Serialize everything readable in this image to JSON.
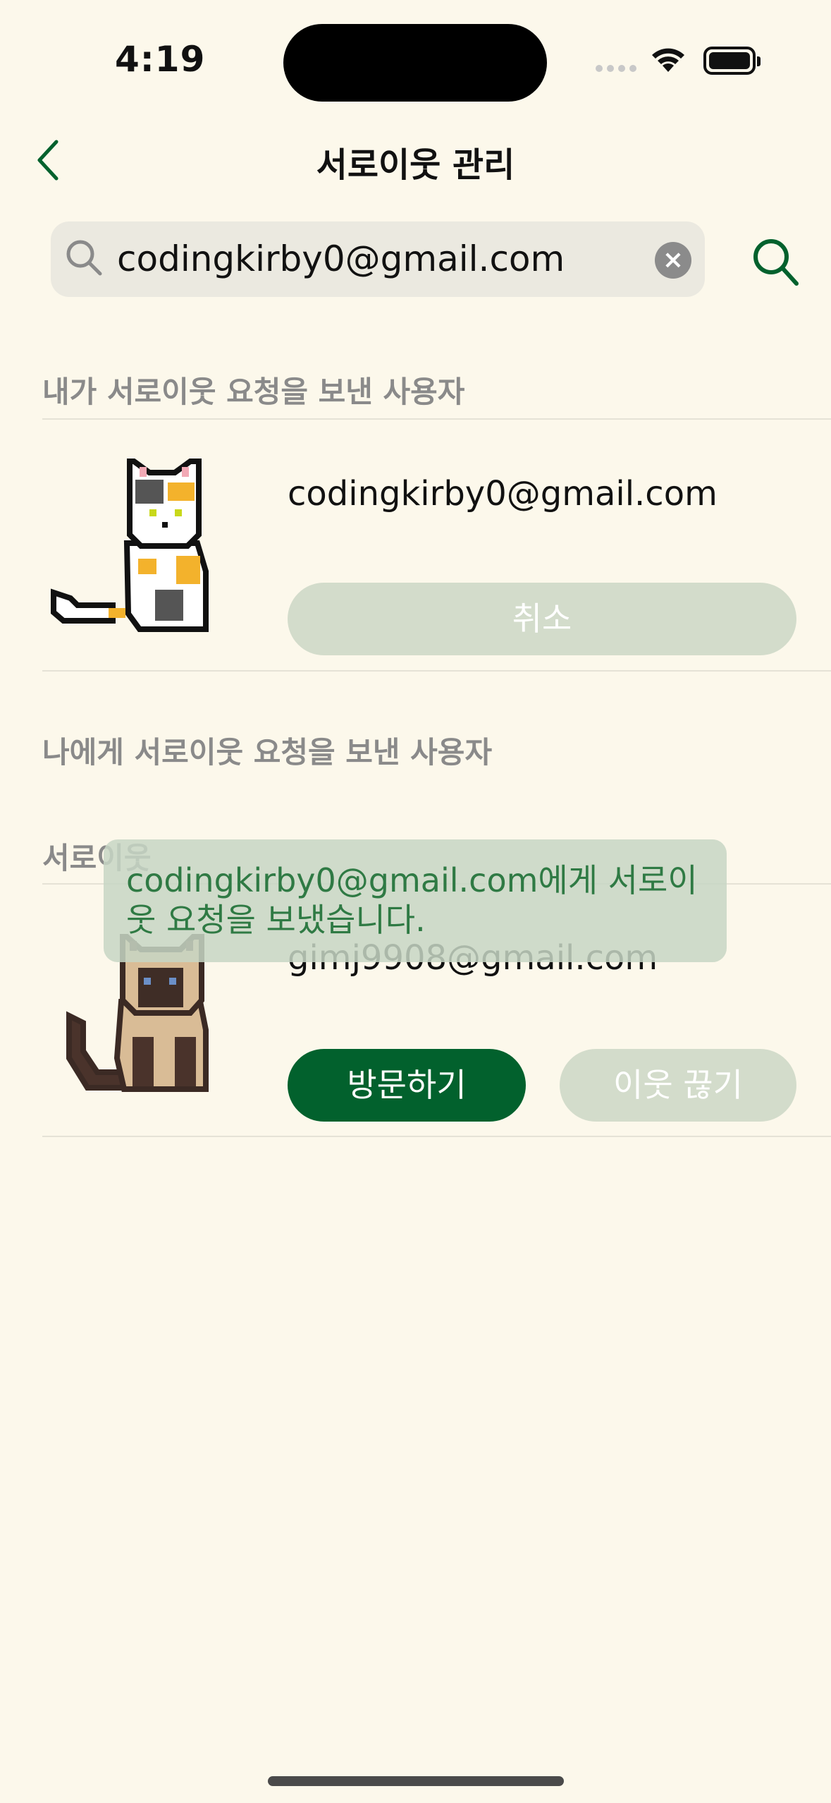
{
  "status": {
    "time": "4:19"
  },
  "nav": {
    "title": "서로이웃 관리"
  },
  "search": {
    "value": "codingkirby0@gmail.com"
  },
  "sent": {
    "label": "내가 서로이웃 요청을 보낸 사용자",
    "user": {
      "email": "codingkirby0@gmail.com",
      "cancel_label": "취소"
    }
  },
  "received": {
    "label": "나에게 서로이웃 요청을 보낸 사용자"
  },
  "neighbors": {
    "label": "서로이웃",
    "user": {
      "email": "gimj9908@gmail.com",
      "visit_label": "방문하기",
      "unfriend_label": "이웃 끊기"
    }
  },
  "toast": {
    "message": "codingkirby0@gmail.com에게 서로이웃 요청을 보냈습니다."
  },
  "colors": {
    "accent": "#02612d",
    "background": "#fcf8eb",
    "muted_button": "#d3dccb"
  }
}
